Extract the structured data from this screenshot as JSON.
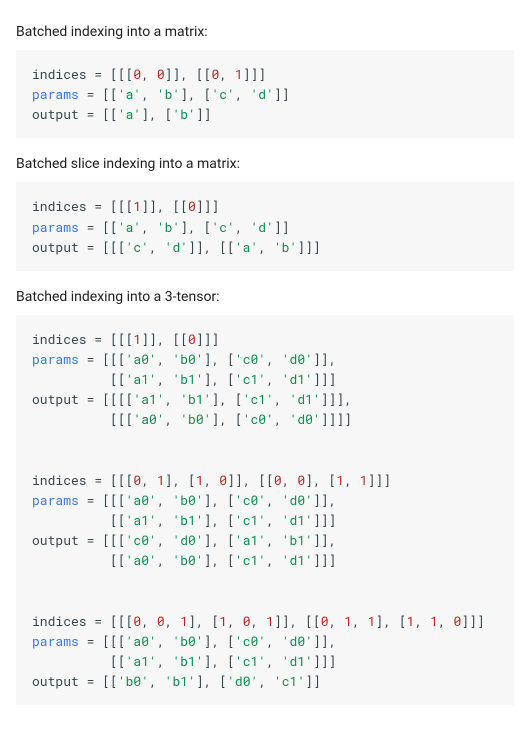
{
  "sections": [
    {
      "desc": "Batched indexing into a matrix:",
      "code": "indices = [[[0, 0]], [[0, 1]]]\nparams = [['a', 'b'], ['c', 'd']]\noutput = [['a'], ['b']]"
    },
    {
      "desc": "Batched slice indexing into a matrix:",
      "code": "indices = [[[1]], [[0]]]\nparams = [['a', 'b'], ['c', 'd']]\noutput = [[['c', 'd']], [['a', 'b']]]"
    },
    {
      "desc": "Batched indexing into a 3-tensor:",
      "code": "indices = [[[1]], [[0]]]\nparams = [[['a0', 'b0'], ['c0', 'd0']],\n          [['a1', 'b1'], ['c1', 'd1']]]\noutput = [[[['a1', 'b1'], ['c1', 'd1']]],\n          [[['a0', 'b0'], ['c0', 'd0']]]]\n\n\nindices = [[[0, 1], [1, 0]], [[0, 0], [1, 1]]]\nparams = [[['a0', 'b0'], ['c0', 'd0']],\n          [['a1', 'b1'], ['c1', 'd1']]]\noutput = [[['c0', 'd0'], ['a1', 'b1']],\n          [['a0', 'b0'], ['c1', 'd1']]]\n\n\nindices = [[[0, 0, 1], [1, 0, 1]], [[0, 1, 1], [1, 1, 0]]]\nparams = [[['a0', 'b0'], ['c0', 'd0']],\n          [['a1', 'b1'], ['c1', 'd1']]]\noutput = [['b0', 'b1'], ['d0', 'c1']]"
    }
  ]
}
